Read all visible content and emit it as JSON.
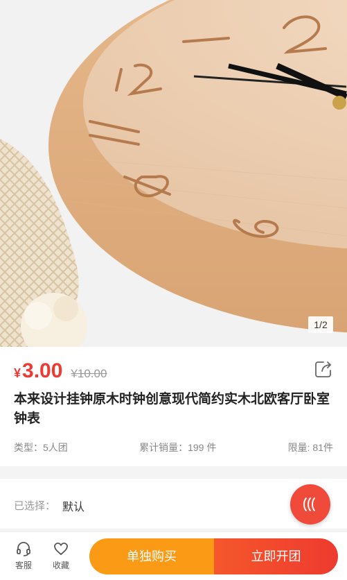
{
  "gallery": {
    "pager": "1/2"
  },
  "product": {
    "currency": "¥",
    "price": "3.00",
    "original_price": "¥10.00",
    "title": "本来设计挂钟原木时钟创意现代简约实木北欧客厅卧室钟表",
    "type_label": "类型：5人团",
    "sales_label": "累计销量：199 件",
    "limit_label": "限量: 81件"
  },
  "selection": {
    "label": "已选择：",
    "value": "默认"
  },
  "bottom_bar": {
    "service_label": "客服",
    "favorite_label": "收藏",
    "buy_alone_label": "单独购买",
    "group_buy_label": "立即开团"
  },
  "colors": {
    "accent": "#ee3a33",
    "orange": "#fb9a15"
  }
}
